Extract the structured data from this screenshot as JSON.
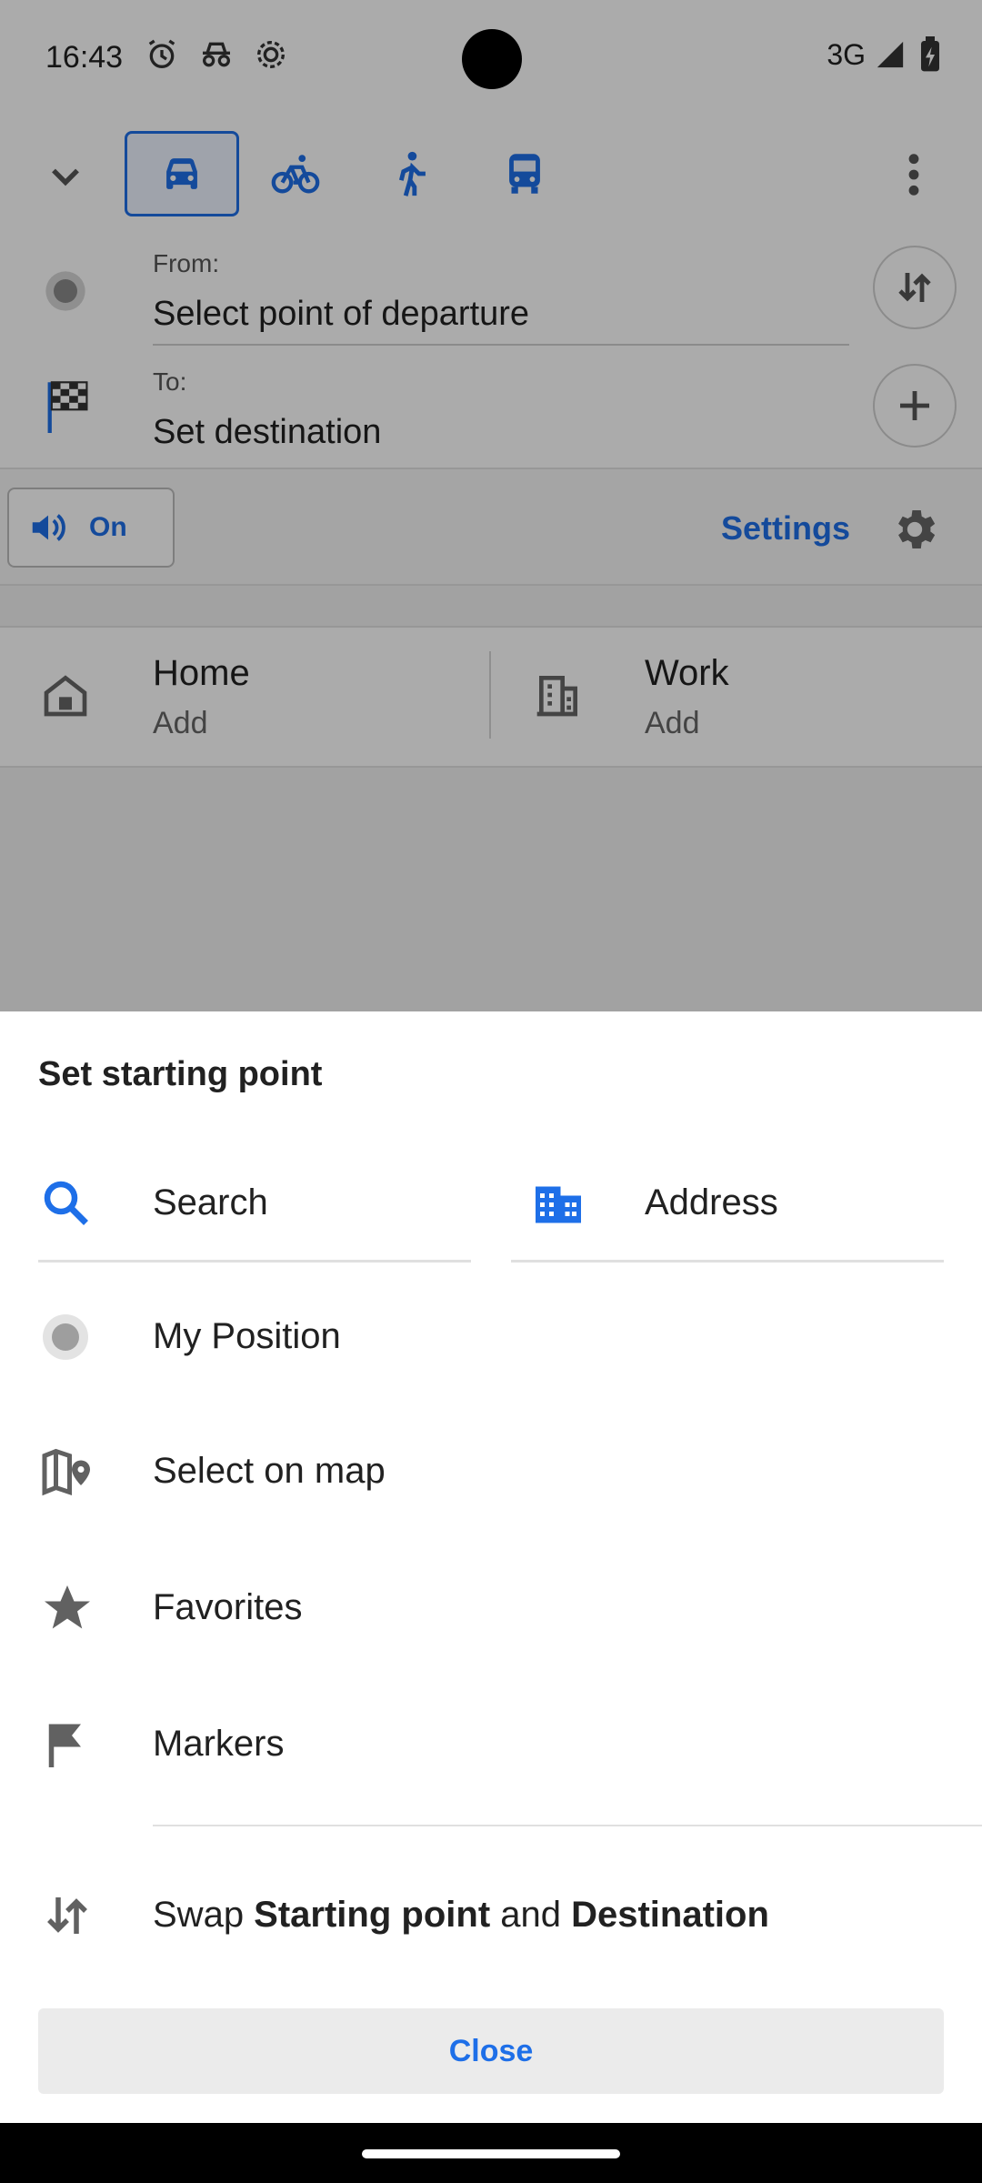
{
  "status_bar": {
    "time": "16:43",
    "network": "3G"
  },
  "route_panel": {
    "modes": [
      "car",
      "bicycle",
      "pedestrian",
      "public-transport"
    ],
    "active_mode": "car",
    "from_label": "From:",
    "from_value": "Select point of departure",
    "to_label": "To:",
    "to_value": "Set destination",
    "voice_label": "On",
    "settings_label": "Settings",
    "home_title": "Home",
    "home_sub": "Add",
    "work_title": "Work",
    "work_sub": "Add"
  },
  "sheet": {
    "title": "Set starting point",
    "search_label": "Search",
    "address_label": "Address",
    "my_position_label": "My Position",
    "select_on_map_label": "Select on map",
    "favorites_label": "Favorites",
    "markers_label": "Markers",
    "swap_prefix": "Swap ",
    "swap_start": "Starting point",
    "swap_mid": " and ",
    "swap_dest": "Destination",
    "close_label": "Close"
  },
  "colors": {
    "accent": "#1e6fe8",
    "dim_overlay": "rgba(0,0,0,0.33)",
    "icon_gray": "#616161"
  }
}
